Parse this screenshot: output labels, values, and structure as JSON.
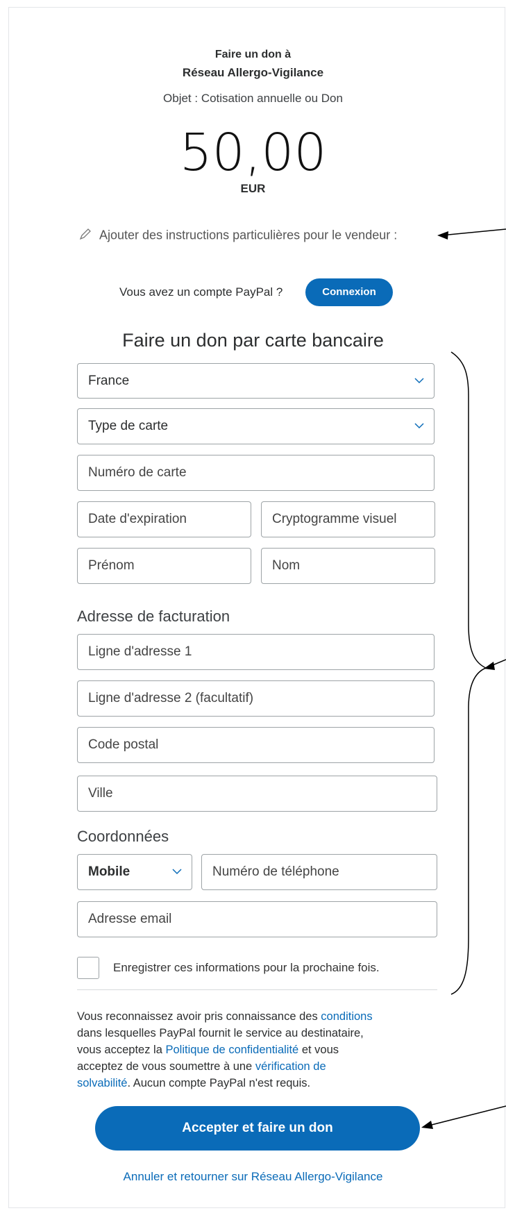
{
  "header": {
    "line1": "Faire un don à",
    "line2": "Réseau Allergo-Vigilance",
    "object": "Objet : Cotisation annuelle ou Don",
    "amount": "50,00",
    "currency": "EUR"
  },
  "instructions_link": "Ajouter des instructions particulières pour le vendeur :",
  "login": {
    "question": "Vous avez un compte PayPal ?",
    "button": "Connexion"
  },
  "card_section": {
    "title": "Faire un don par carte bancaire",
    "country": "France",
    "card_type": "Type de carte",
    "card_number": "Numéro de carte",
    "expiry": "Date d'expiration",
    "cvv": "Cryptogramme visuel",
    "first_name": "Prénom",
    "last_name": "Nom"
  },
  "billing": {
    "title": "Adresse de facturation",
    "address1": "Ligne d'adresse 1",
    "address2": "Ligne d'adresse 2 (facultatif)",
    "postal": "Code postal",
    "city": "Ville"
  },
  "contact": {
    "title": "Coordonnées",
    "phone_type": "Mobile",
    "phone": "Numéro de téléphone",
    "email": "Adresse email"
  },
  "save_label": "Enregistrer ces informations pour la prochaine fois.",
  "legal": {
    "t1": "Vous reconnaissez avoir pris connaissance des",
    "l1": "conditions",
    "t2": "dans lesquelles PayPal fournit le service au destinataire,",
    "t3": "vous acceptez la",
    "l2": "Politique de confidentialité",
    "t4": "et vous",
    "t5": "acceptez de vous soumettre à une",
    "l3": "vérification de",
    "l4": "solvabilité",
    "t6": ". Aucun compte PayPal n'est requis."
  },
  "submit": "Accepter et faire un don",
  "cancel": "Annuler et retourner sur Réseau Allergo-Vigilance",
  "colors": {
    "brand": "#0a6bb8",
    "border": "#9da3a6"
  }
}
